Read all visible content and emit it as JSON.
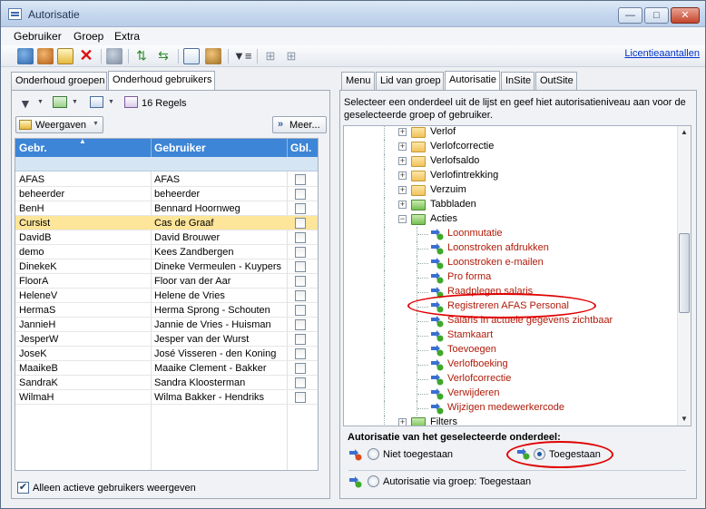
{
  "window": {
    "title": "Autorisatie",
    "minimize": "—",
    "maximize": "□",
    "close": "✕"
  },
  "menu": [
    "Gebruiker",
    "Groep",
    "Extra"
  ],
  "toolbar": {
    "license_link": "Licentieaantallen"
  },
  "left_tabs": [
    "Onderhoud groepen",
    "Onderhoud gebruikers"
  ],
  "left_toolbar": {
    "records": "16 Regels",
    "views": "Weergaven",
    "more": "Meer..."
  },
  "grid": {
    "columns": [
      "Gebr.",
      "Gebruiker",
      "Gbl."
    ],
    "rows": [
      {
        "code": "AFAS",
        "name": "AFAS",
        "selected": false
      },
      {
        "code": "beheerder",
        "name": "beheerder",
        "selected": false
      },
      {
        "code": "BenH",
        "name": "Bennard Hoornweg",
        "selected": false
      },
      {
        "code": "Cursist",
        "name": "Cas de Graaf",
        "selected": true
      },
      {
        "code": "DavidB",
        "name": "David Brouwer",
        "selected": false
      },
      {
        "code": "demo",
        "name": "Kees Zandbergen",
        "selected": false
      },
      {
        "code": "DinekeK",
        "name": "Dineke Vermeulen - Kuypers",
        "selected": false
      },
      {
        "code": "FloorA",
        "name": "Floor van der Aar",
        "selected": false
      },
      {
        "code": "HeleneV",
        "name": "Helene de Vries",
        "selected": false
      },
      {
        "code": "HermaS",
        "name": "Herma Sprong - Schouten",
        "selected": false
      },
      {
        "code": "JannieH",
        "name": "Jannie de Vries - Huisman",
        "selected": false
      },
      {
        "code": "JesperW",
        "name": "Jesper van der Wurst",
        "selected": false
      },
      {
        "code": "JoseK",
        "name": "José Visseren - den Koning",
        "selected": false
      },
      {
        "code": "MaaikeB",
        "name": "Maaike Clement - Bakker",
        "selected": false
      },
      {
        "code": "SandraK",
        "name": "Sandra Kloosterman",
        "selected": false
      },
      {
        "code": "WilmaH",
        "name": "Wilma Bakker - Hendriks",
        "selected": false
      }
    ]
  },
  "active_only_label": "Alleen actieve gebruikers weergeven",
  "right_tabs": [
    "Menu",
    "Lid van groep",
    "Autorisatie",
    "InSite",
    "OutSite"
  ],
  "instruction": "Selecteer een onderdeel uit de lijst en geef hiet autorisatieniveau aan voor de geselecteerde groep of gebruiker.",
  "tree": {
    "folders_top": [
      "Verlof",
      "Verlofcorrectie",
      "Verlofsaldo",
      "Verlofintrekking",
      "Verzuim",
      "Tabbladen",
      "Acties"
    ],
    "actions": [
      "Loonmutatie",
      "Loonstroken afdrukken",
      "Loonstroken e-mailen",
      "Pro forma",
      "Raadplegen salaris",
      "Registreren AFAS Personal",
      "Salaris in actuele gegevens zichtbaar",
      "Stamkaart",
      "Toevoegen",
      "Verlofboeking",
      "Verlofcorrectie",
      "Verwijderen",
      "Wijzigen medewerkercode"
    ],
    "folders_bottom": [
      "Filters"
    ]
  },
  "auth": {
    "heading": "Autorisatie van het geselecteerde onderdeel:",
    "option_denied": "Niet toegestaan",
    "option_allowed": "Toegestaan",
    "via_group": "Autorisatie via groep: Toegestaan"
  }
}
